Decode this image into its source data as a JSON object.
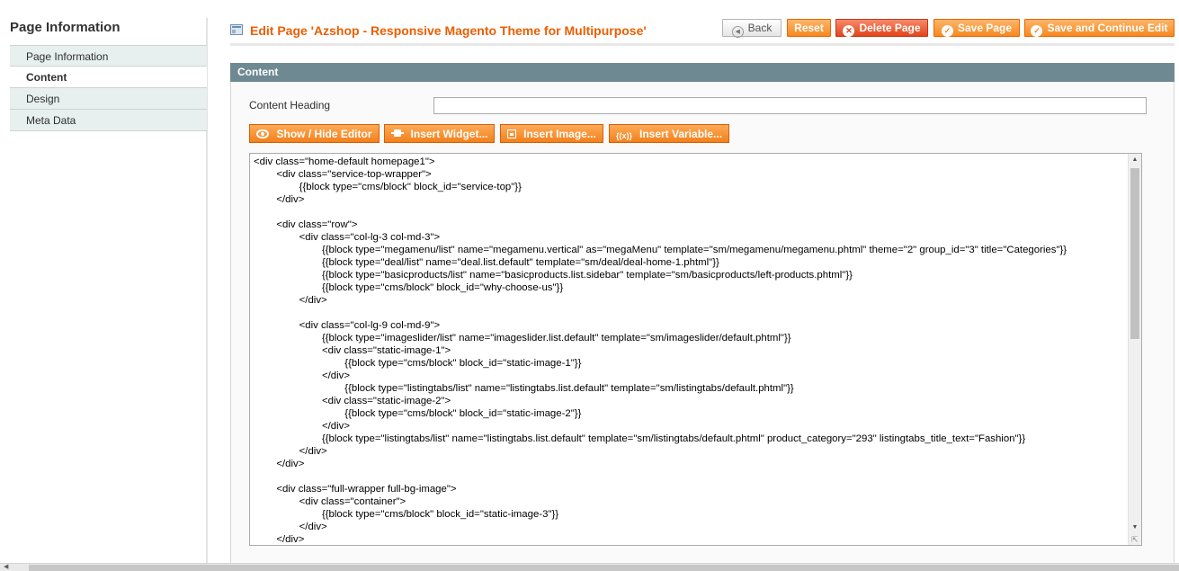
{
  "sidebar": {
    "title": "Page Information",
    "tabs": [
      {
        "label": "Page Information"
      },
      {
        "label": "Content"
      },
      {
        "label": "Design"
      },
      {
        "label": "Meta Data"
      }
    ],
    "active_tab": "Content"
  },
  "header": {
    "title": "Edit Page 'Azshop - Responsive Magento Theme for Multipurpose'",
    "buttons": {
      "back": "Back",
      "reset": "Reset",
      "delete": "Delete Page",
      "save": "Save Page",
      "save_continue": "Save and Continue Edit"
    }
  },
  "content": {
    "section_title": "Content",
    "heading_label": "Content Heading",
    "heading_value": "",
    "editor_buttons": {
      "show_hide": "Show / Hide Editor",
      "insert_widget": "Insert Widget...",
      "insert_image": "Insert Image...",
      "insert_variable": "Insert Variable..."
    },
    "code_lines": [
      "<div class=\"home-default homepage1\">",
      "        <div class=\"service-top-wrapper\">",
      "                {{block type=\"cms/block\" block_id=\"service-top\"}}",
      "        </div>",
      "",
      "        <div class=\"row\">",
      "                <div class=\"col-lg-3 col-md-3\">",
      "                        {{block type=\"megamenu/list\" name=\"megamenu.vertical\" as=\"megaMenu\" template=\"sm/megamenu/megamenu.phtml\" theme=\"2\" group_id=\"3\" title=\"Categories\"}}",
      "                        {{block type=\"deal/list\" name=\"deal.list.default\" template=\"sm/deal/deal-home-1.phtml\"}}",
      "                        {{block type=\"basicproducts/list\" name=\"basicproducts.list.sidebar\" template=\"sm/basicproducts/left-products.phtml\"}}",
      "                        {{block type=\"cms/block\" block_id=\"why-choose-us\"}}",
      "                </div>",
      "",
      "                <div class=\"col-lg-9 col-md-9\">",
      "                        {{block type=\"imageslider/list\" name=\"imageslider.list.default\" template=\"sm/imageslider/default.phtml\"}}",
      "                        <div class=\"static-image-1\">",
      "                                {{block type=\"cms/block\" block_id=\"static-image-1\"}}",
      "                        </div>",
      "                                {{block type=\"listingtabs/list\" name=\"listingtabs.list.default\" template=\"sm/listingtabs/default.phtml\"}}",
      "                        <div class=\"static-image-2\">",
      "                                {{block type=\"cms/block\" block_id=\"static-image-2\"}}",
      "                        </div>",
      "                        {{block type=\"listingtabs/list\" name=\"listingtabs.list.default\" template=\"sm/listingtabs/default.phtml\" product_category=\"293\" listingtabs_title_text=\"Fashion\"}}",
      "                </div>",
      "        </div>",
      "",
      "        <div class=\"full-wrapper full-bg-image\">",
      "                <div class=\"container\">",
      "                        {{block type=\"cms/block\" block_id=\"static-image-3\"}}",
      "                </div>",
      "        </div>"
    ]
  },
  "colors": {
    "accent": "#eb5e00",
    "button": "#f6891f",
    "delete": "#e3451c",
    "section_header": "#6f8992"
  }
}
